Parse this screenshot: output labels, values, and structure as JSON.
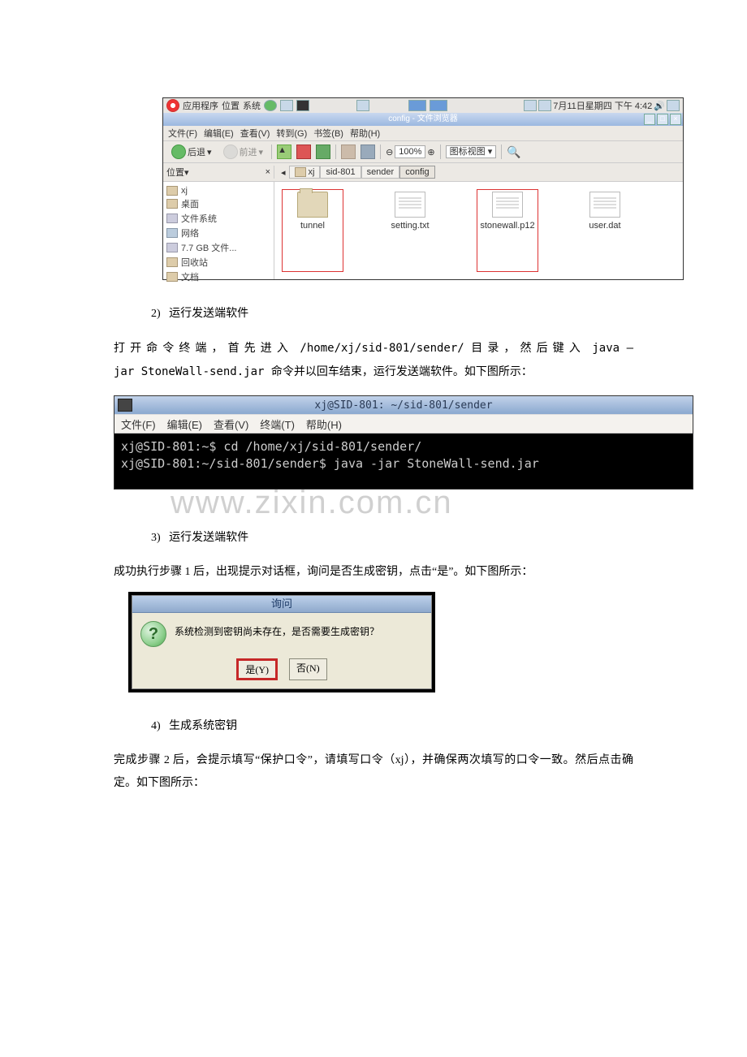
{
  "fm": {
    "top": {
      "apps_label": "应用程序",
      "places_label": "位置",
      "system_label": "系统",
      "clock": "7月11日星期四 下午 4:42"
    },
    "title": "config - 文件浏览器",
    "menubar": [
      "文件(F)",
      "编辑(E)",
      "查看(V)",
      "转到(G)",
      "书签(B)",
      "帮助(H)"
    ],
    "toolbar": {
      "back": "后退",
      "forward": "前进",
      "zoom": "100%",
      "viewmode": "图标视图"
    },
    "places_header": "位置",
    "breadcrumbs": [
      "xj",
      "sid-801",
      "sender",
      "config"
    ],
    "sidebar": [
      {
        "icon": "folder",
        "label": "xj"
      },
      {
        "icon": "folder",
        "label": "桌面"
      },
      {
        "icon": "drive",
        "label": "文件系统"
      },
      {
        "icon": "net",
        "label": "网络"
      },
      {
        "icon": "drive",
        "label": "7.7 GB 文件..."
      },
      {
        "icon": "folder",
        "label": "回收站"
      },
      {
        "icon": "folder",
        "label": "文档"
      }
    ],
    "files": [
      {
        "name": "tunnel",
        "type": "folder",
        "highlight": true
      },
      {
        "name": "setting.txt",
        "type": "file",
        "highlight": false
      },
      {
        "name": "stonewall.p12",
        "type": "file",
        "highlight": true
      },
      {
        "name": "user.dat",
        "type": "file",
        "highlight": false
      }
    ]
  },
  "steps": {
    "s2_num": "2)",
    "s2_title": "运行发送端软件",
    "s3_num": "3)",
    "s3_title": "运行发送端软件",
    "s4_num": "4)",
    "s4_title": "生成系统密钥"
  },
  "para1a": "打开命令终端，首先进入",
  "para1_path": " /home/xj/sid-801/sender/ ",
  "para1b": "目录，然后键入",
  "para1_cmd": " java –jar StoneWall-send.jar ",
  "para1c": "命令并以回车结束，运行发送端软件。如下图所示：",
  "terminal": {
    "title": "xj@SID-801: ~/sid-801/sender",
    "menu": [
      "文件(F)",
      "编辑(E)",
      "查看(V)",
      "终端(T)",
      "帮助(H)"
    ],
    "line1": "xj@SID-801:~$ cd /home/xj/sid-801/sender/",
    "line2": "xj@SID-801:~/sid-801/sender$ java -jar StoneWall-send.jar"
  },
  "watermark": "www.zixin.com.cn",
  "para2": "成功执行步骤 1 后，出现提示对话框，询问是否生成密钥，点击“是”。如下图所示：",
  "dialog": {
    "title": "询问",
    "text": "系统检测到密钥尚未存在，是否需要生成密钥？",
    "yes": "是(Y)",
    "no": "否(N)"
  },
  "para3": "完成步骤 2 后，会提示填写“保护口令”，请填写口令（xj），并确保两次填写的口令一致。然后点击确定。如下图所示："
}
